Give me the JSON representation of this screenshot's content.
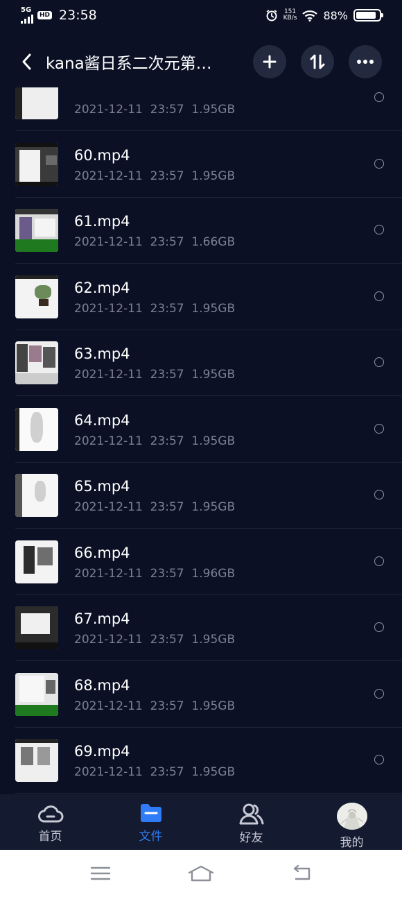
{
  "status": {
    "network": "5G",
    "hd": "HD",
    "time": "23:58",
    "speed_value": "151",
    "speed_unit": "KB/s",
    "battery": "88%",
    "battery_level": 0.88
  },
  "header": {
    "title": "kana酱日系二次元第…",
    "back_icon": "chevron-left-icon",
    "add_icon": "plus-icon",
    "sort_icon": "sort-arrows-icon",
    "more_icon": "more-dots-icon"
  },
  "files": [
    {
      "name": "",
      "date": "2021-12-11",
      "time": "23:57",
      "size": "1.95GB"
    },
    {
      "name": "60.mp4",
      "date": "2021-12-11",
      "time": "23:57",
      "size": "1.95GB"
    },
    {
      "name": "61.mp4",
      "date": "2021-12-11",
      "time": "23:57",
      "size": "1.66GB"
    },
    {
      "name": "62.mp4",
      "date": "2021-12-11",
      "time": "23:57",
      "size": "1.95GB"
    },
    {
      "name": "63.mp4",
      "date": "2021-12-11",
      "time": "23:57",
      "size": "1.95GB"
    },
    {
      "name": "64.mp4",
      "date": "2021-12-11",
      "time": "23:57",
      "size": "1.95GB"
    },
    {
      "name": "65.mp4",
      "date": "2021-12-11",
      "time": "23:57",
      "size": "1.95GB"
    },
    {
      "name": "66.mp4",
      "date": "2021-12-11",
      "time": "23:57",
      "size": "1.96GB"
    },
    {
      "name": "67.mp4",
      "date": "2021-12-11",
      "time": "23:57",
      "size": "1.95GB"
    },
    {
      "name": "68.mp4",
      "date": "2021-12-11",
      "time": "23:57",
      "size": "1.95GB"
    },
    {
      "name": "69.mp4",
      "date": "2021-12-11",
      "time": "23:57",
      "size": "1.95GB"
    }
  ],
  "tabs": [
    {
      "label": "首页",
      "icon": "cloud-icon",
      "active": false
    },
    {
      "label": "文件",
      "icon": "folder-icon",
      "active": true
    },
    {
      "label": "好友",
      "icon": "friends-icon",
      "active": false
    },
    {
      "label": "我的",
      "icon": "avatar",
      "active": false
    }
  ],
  "colors": {
    "background": "#0b1024",
    "accent": "#2f7cf6",
    "meta_text": "#7c8193",
    "tabbar": "#141a2f"
  }
}
